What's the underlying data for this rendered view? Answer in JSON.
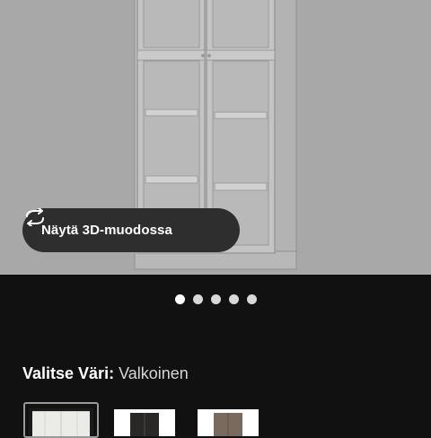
{
  "viewer": {
    "view3d_label": "Näytä 3D-muodossa",
    "view3d_icon": "rotate-3d-icon",
    "image_count": 5,
    "active_index": 0
  },
  "color_select": {
    "label": "Valitse Väri:",
    "value": "Valkoinen",
    "options": [
      {
        "name": "white",
        "color": "#e9e9e6",
        "selected": true
      },
      {
        "name": "black",
        "color": "#2a2827",
        "selected": false
      },
      {
        "name": "brown",
        "color": "#7a6a5e",
        "selected": false
      }
    ]
  },
  "colors": {
    "hero_background": "#a8a8a8",
    "page_background": "#111111",
    "button_background": "#2e2e2e"
  }
}
